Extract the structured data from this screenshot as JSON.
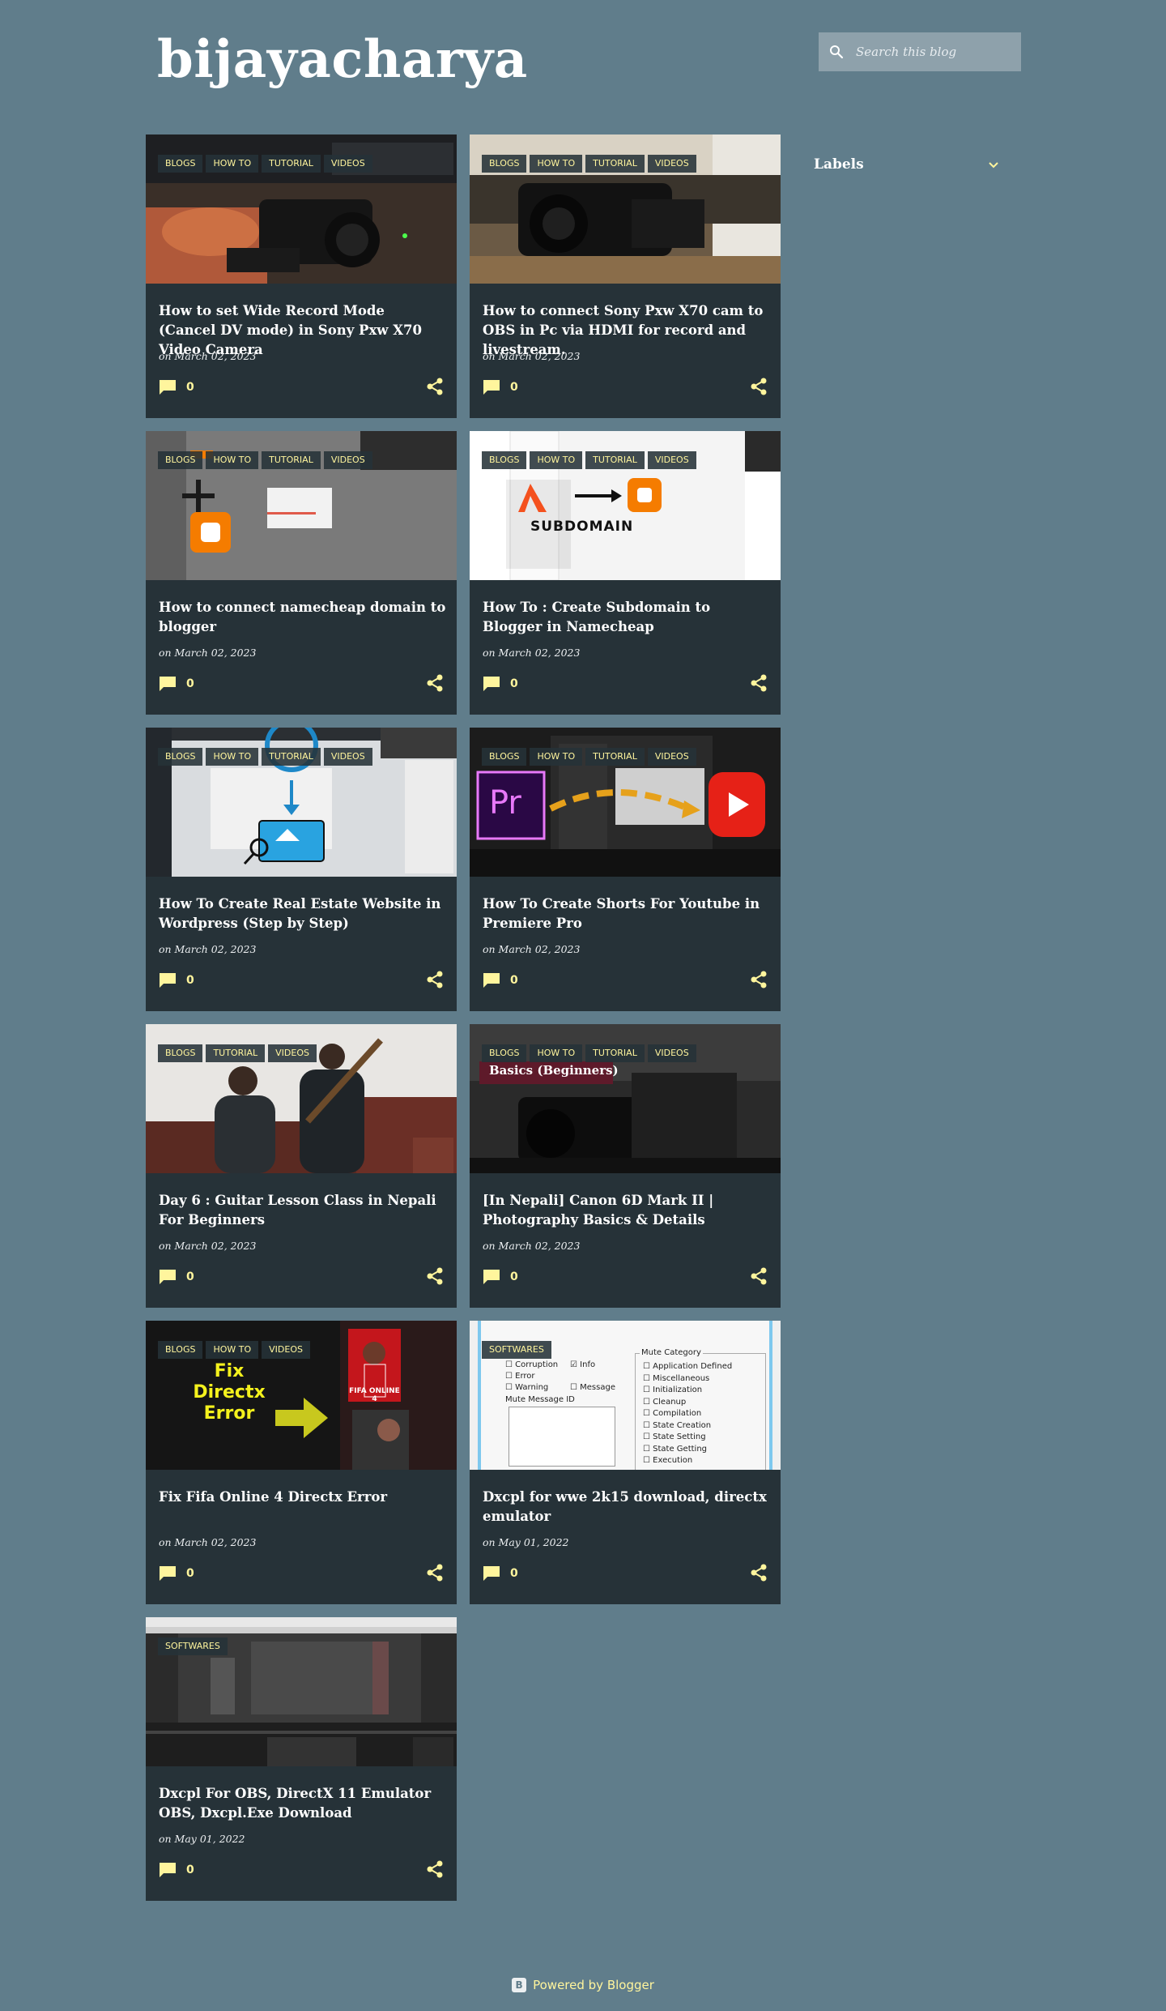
{
  "blog": {
    "title": "bijayacharya"
  },
  "search": {
    "placeholder": "Search this blog"
  },
  "sidebar": {
    "labels_title": "Labels"
  },
  "posts": [
    {
      "tags": [
        "BLOGS",
        "HOW TO",
        "TUTORIAL",
        "VIDEOS"
      ],
      "title": "How to set Wide Record Mode (Cancel DV mode) in Sony Pxw X70 Video Camera",
      "date": "on March 02, 2023",
      "comments": "0"
    },
    {
      "tags": [
        "BLOGS",
        "HOW TO",
        "TUTORIAL",
        "VIDEOS"
      ],
      "title": "How to connect Sony Pxw X70 cam to OBS in Pc via HDMI for record and livestream.",
      "date": "on March 02, 2023",
      "comments": "0"
    },
    {
      "tags": [
        "BLOGS",
        "HOW TO",
        "TUTORIAL",
        "VIDEOS"
      ],
      "title": "How to connect namecheap domain to blogger",
      "date": "on March 02, 2023",
      "comments": "0"
    },
    {
      "tags": [
        "BLOGS",
        "HOW TO",
        "TUTORIAL",
        "VIDEOS"
      ],
      "title": "How To : Create Subdomain to Blogger in Namecheap",
      "date": "on March 02, 2023",
      "comments": "0",
      "thumb_text": "SUBDOMAIN"
    },
    {
      "tags": [
        "BLOGS",
        "HOW TO",
        "TUTORIAL",
        "VIDEOS"
      ],
      "title": "How To Create Real Estate Website in Wordpress (Step by Step)",
      "date": "on March 02, 2023",
      "comments": "0"
    },
    {
      "tags": [
        "BLOGS",
        "HOW TO",
        "TUTORIAL",
        "VIDEOS"
      ],
      "title": "How To Create Shorts For Youtube in Premiere Pro",
      "date": "on March 02, 2023",
      "comments": "0",
      "thumb_text": "Pr"
    },
    {
      "tags": [
        "BLOGS",
        "TUTORIAL",
        "VIDEOS"
      ],
      "title": "Day 6 : Guitar Lesson Class in Nepali For Beginners",
      "date": "on March 02, 2023",
      "comments": "0"
    },
    {
      "tags": [
        "BLOGS",
        "HOW TO",
        "TUTORIAL",
        "VIDEOS"
      ],
      "title": "[In Nepali] Canon 6D Mark II | Photography Basics & Details",
      "date": "on March 02, 2023",
      "comments": "0",
      "thumb_text": "Basics (Beginners)"
    },
    {
      "tags": [
        "BLOGS",
        "HOW TO",
        "VIDEOS"
      ],
      "title": "Fix Fifa Online 4 Directx Error",
      "date": "on March 02, 2023",
      "comments": "0",
      "thumb_text": "Fix Directx Error",
      "thumb_text2": "FIFA ONLINE 4"
    },
    {
      "tags": [
        "SOFTWARES"
      ],
      "title": "Dxcpl for wwe 2k15 download, directx emulator",
      "date": "on May 01, 2022",
      "comments": "0",
      "thumb_items": [
        "Corruption",
        "Error",
        "Warning",
        "Info",
        "Message",
        "Mute Message ID",
        "Mute Category",
        "Application Defined",
        "Miscellaneous",
        "Initialization",
        "Cleanup",
        "Compilation",
        "State Creation",
        "State Setting",
        "State Getting",
        "Execution"
      ]
    },
    {
      "tags": [
        "SOFTWARES"
      ],
      "title": "Dxcpl For OBS, DirectX 11 Emulator OBS, Dxcpl.Exe Download",
      "date": "on May 01, 2022",
      "comments": "0"
    }
  ],
  "footer": {
    "powered": "Powered by Blogger"
  },
  "colors": {
    "background": "#607d8b",
    "card": "#263238",
    "accent": "#fff59d"
  },
  "icons": {
    "search": "search-icon",
    "comment": "comment-icon",
    "share": "share-icon",
    "chevron": "chevron-down-icon",
    "blogger": "blogger-icon"
  }
}
